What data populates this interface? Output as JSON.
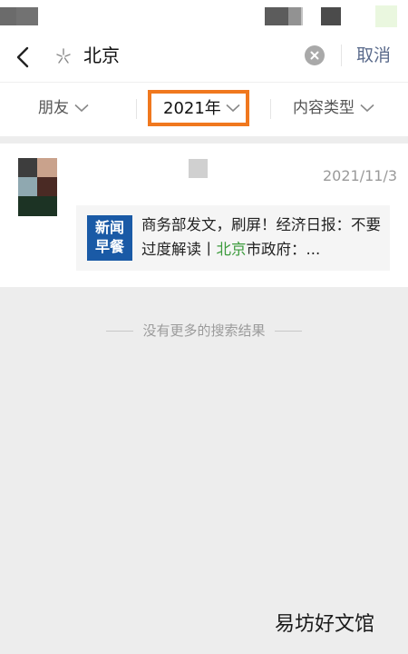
{
  "header": {
    "query": "北京",
    "cancel_label": "取消"
  },
  "filters": {
    "friends_label": "朋友",
    "year_label": "2021年",
    "content_type_label": "内容类型"
  },
  "result": {
    "date": "2021/11/3",
    "logo_line1": "新闻",
    "logo_line2": "早餐",
    "text_part1": "商务部发文，刷屏！经济日报：不要过度解读丨",
    "highlight": "北京",
    "text_part2": "市政府：..."
  },
  "footer": {
    "no_more_label": "没有更多的搜索结果"
  },
  "watermark": "易坊好文馆",
  "colors": {
    "accent_orange": "#f0781e",
    "cancel_blue": "#5b6b8c",
    "highlight_green": "#3c9b3c",
    "logo_blue": "#1a5aa6"
  }
}
